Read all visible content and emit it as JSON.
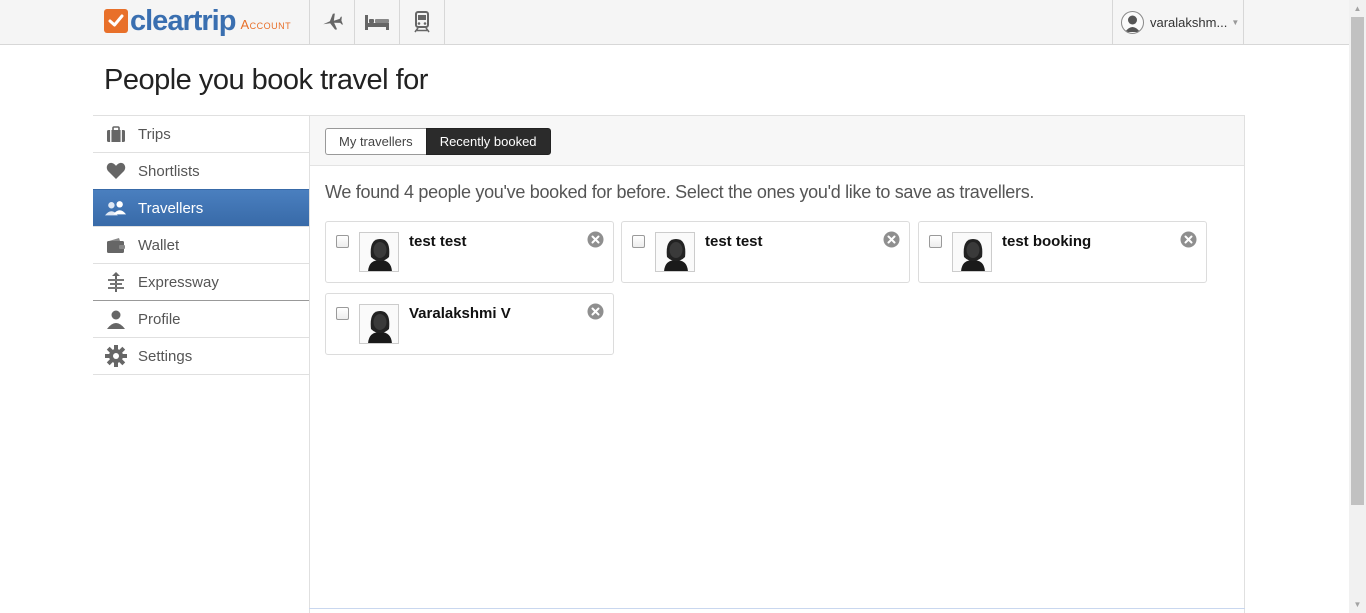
{
  "header": {
    "logo_text": "cleartrip",
    "logo_sub": "Account",
    "nav_icons": [
      "flight-icon",
      "hotel-bed-icon",
      "train-icon"
    ],
    "user_name": "varalakshm...",
    "accent": "#e8702a",
    "brand": "#3a6fb0"
  },
  "page": {
    "title": "People you book travel for"
  },
  "sidebar": {
    "items": [
      {
        "label": "Trips",
        "icon": "briefcase-icon",
        "active": false
      },
      {
        "label": "Shortlists",
        "icon": "heart-icon",
        "active": false
      },
      {
        "label": "Travellers",
        "icon": "people-icon",
        "active": true
      },
      {
        "label": "Wallet",
        "icon": "wallet-icon",
        "active": false
      },
      {
        "label": "Expressway",
        "icon": "expressway-icon",
        "active": false
      },
      {
        "label": "Profile",
        "icon": "person-icon",
        "active": false
      },
      {
        "label": "Settings",
        "icon": "gear-icon",
        "active": false
      }
    ],
    "active_color": "#3a6fb0"
  },
  "tabs": {
    "my_travellers": "My travellers",
    "recently_booked": "Recently booked"
  },
  "main": {
    "found_message": "We found 4 people you've booked for before. Select the ones you'd like to save as travellers.",
    "travellers": [
      {
        "name": "test test",
        "checked": false
      },
      {
        "name": "test test",
        "checked": false
      },
      {
        "name": "test booking",
        "checked": false
      },
      {
        "name": "Varalakshmi V",
        "checked": false
      }
    ]
  }
}
